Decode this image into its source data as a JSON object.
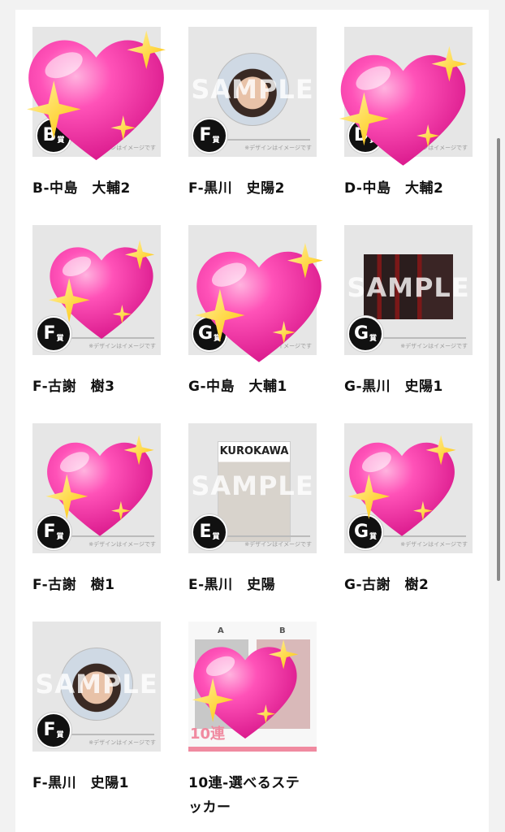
{
  "items": [
    {
      "label": "B-中島　大輔2",
      "grade": "B",
      "thumb": "heart"
    },
    {
      "label": "F-黒川　史陽2",
      "grade": "F",
      "thumb": "circle"
    },
    {
      "label": "D-中島　大輔2",
      "grade": "D",
      "thumb": "heart"
    },
    {
      "label": "F-古謝　樹3",
      "grade": "F",
      "thumb": "heart"
    },
    {
      "label": "G-中島　大輔1",
      "grade": "G",
      "thumb": "heart"
    },
    {
      "label": "G-黒川　史陽1",
      "grade": "G",
      "thumb": "rect"
    },
    {
      "label": "F-古謝　樹1",
      "grade": "F",
      "thumb": "heart"
    },
    {
      "label": "E-黒川　史陽",
      "grade": "E",
      "thumb": "card"
    },
    {
      "label": "G-古謝　樹2",
      "grade": "G",
      "thumb": "heart"
    },
    {
      "label": "F-黒川　史陽1",
      "grade": "F",
      "thumb": "circle"
    },
    {
      "label": "10連-選べるステ\nッカー",
      "grade": "",
      "thumb": "sticker"
    }
  ],
  "prize_suffix": "賞",
  "design_note": "※デザインはイメージです",
  "sample_watermark": "SAMPLE",
  "card_title": "KUROKAWA",
  "sticker_labels": [
    "A",
    "B"
  ],
  "sticker_bottom": "10連",
  "colors": {
    "heart": "#f0389c",
    "sparkle": "#ffd21a",
    "badge": "#111111",
    "background": "#f2f2f2"
  },
  "heart_icon": "sparkling-heart-emoji"
}
